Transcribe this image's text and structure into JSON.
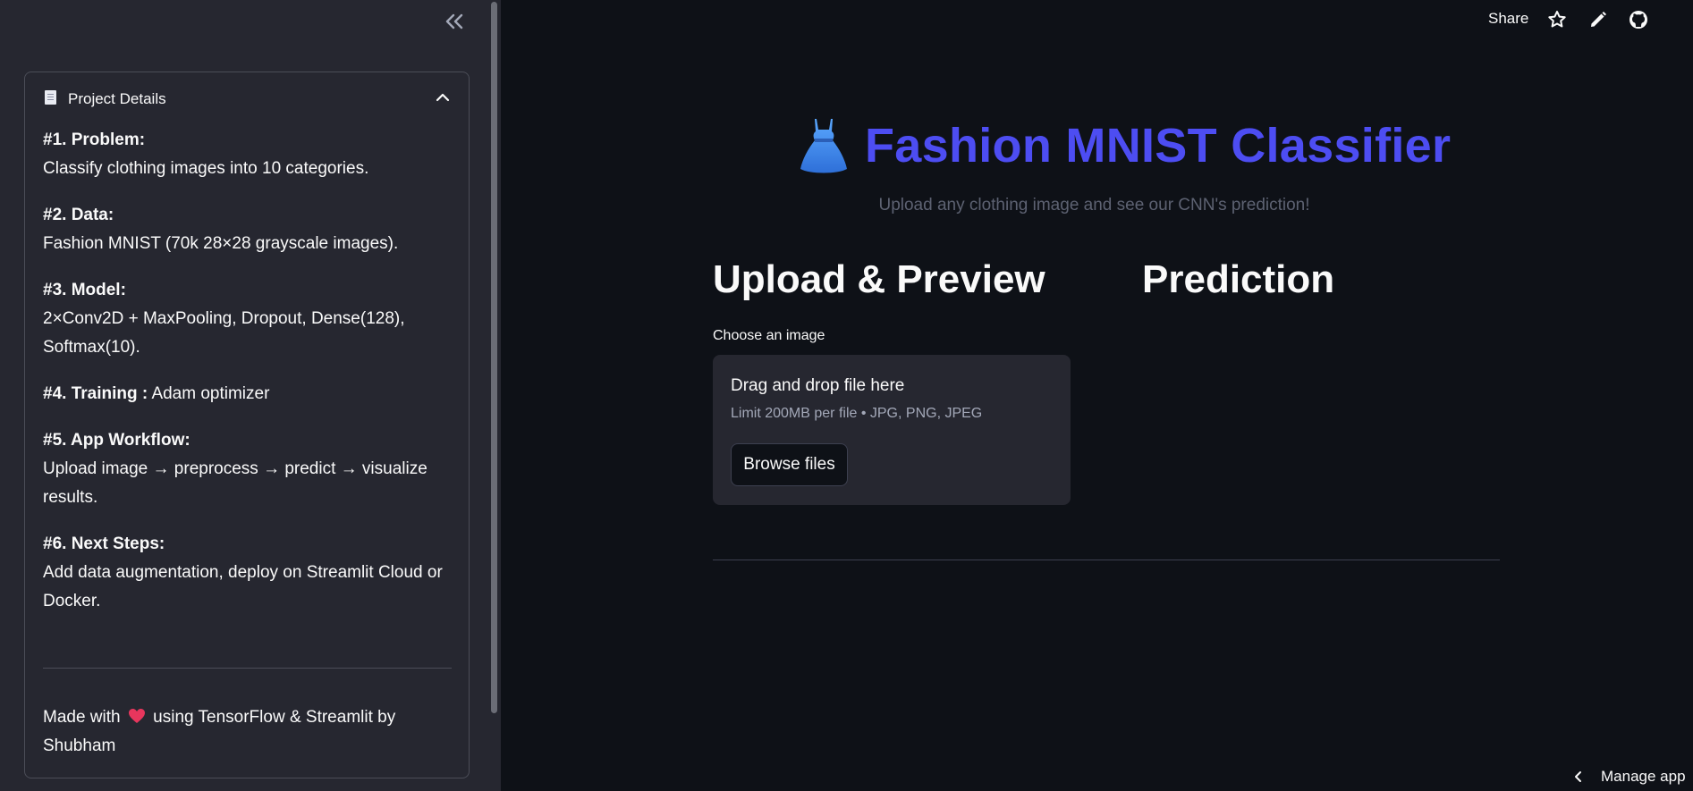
{
  "sidebar": {
    "expander_title": "Project Details",
    "sections": [
      {
        "heading": "#1. Problem:",
        "text": "Classify clothing images into 10 categories."
      },
      {
        "heading": "#2. Data:",
        "text": "Fashion MNIST (70k 28×28 grayscale images)."
      },
      {
        "heading": "#3. Model:",
        "text": "2×Conv2D + MaxPooling, Dropout, Dense(128), Softmax(10)."
      },
      {
        "heading": "#4. Training :",
        "text": "Adam optimizer"
      },
      {
        "heading": "#5. App Workflow:",
        "text": "Upload image → preprocess → predict → visualize results."
      },
      {
        "heading": "#6. Next Steps:",
        "text": "Add data augmentation, deploy on Streamlit Cloud or Docker."
      }
    ],
    "footer_pre": "Made with",
    "footer_post": "using TensorFlow & Streamlit by Shubham"
  },
  "toolbar": {
    "share_label": "Share"
  },
  "main": {
    "title": "Fashion MNIST Classifier",
    "subtitle": "Upload any clothing image and see our CNN's prediction!",
    "upload_heading": "Upload & Preview",
    "prediction_heading": "Prediction",
    "uploader_label": "Choose an image",
    "dropzone_title": "Drag and drop file here",
    "dropzone_limit": "Limit 200MB per file • JPG, PNG, JPEG",
    "browse_label": "Browse files"
  },
  "footer": {
    "manage_app_label": "Manage app"
  },
  "colors": {
    "background": "#0e1117",
    "sidebar": "#262730",
    "title_accent": "#4d4df2"
  }
}
